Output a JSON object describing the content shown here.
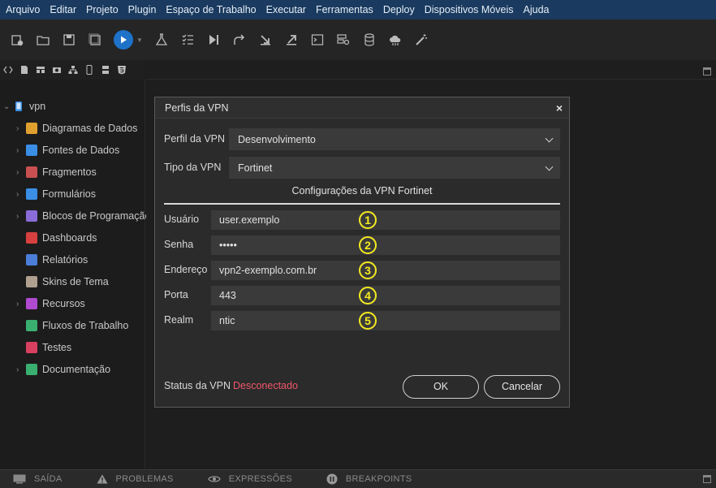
{
  "menu": [
    "Arquivo",
    "Editar",
    "Projeto",
    "Plugin",
    "Espaço de Trabalho",
    "Executar",
    "Ferramentas",
    "Deploy",
    "Dispositivos Móveis",
    "Ajuda"
  ],
  "project": {
    "name": "vpn"
  },
  "tree": [
    {
      "label": "Diagramas de Dados",
      "icon": "diagram-icon",
      "color": "#e0a030",
      "expand": true
    },
    {
      "label": "Fontes de Dados",
      "icon": "datasource-icon",
      "color": "#3a8ee6",
      "expand": true
    },
    {
      "label": "Fragmentos",
      "icon": "fragment-icon",
      "color": "#c85050",
      "expand": true
    },
    {
      "label": "Formulários",
      "icon": "form-icon",
      "color": "#3a8ee6",
      "expand": true
    },
    {
      "label": "Blocos de Programação",
      "icon": "blocks-icon",
      "color": "#8a6cd8",
      "expand": true
    },
    {
      "label": "Dashboards",
      "icon": "dashboard-icon",
      "color": "#d84040",
      "expand": false
    },
    {
      "label": "Relatórios",
      "icon": "report-icon",
      "color": "#4a7ed8",
      "expand": false
    },
    {
      "label": "Skins de Tema",
      "icon": "palette-icon",
      "color": "#b0a090",
      "expand": false
    },
    {
      "label": "Recursos",
      "icon": "resources-icon",
      "color": "#b04ad0",
      "expand": true
    },
    {
      "label": "Fluxos de Trabalho",
      "icon": "workflow-icon",
      "color": "#3ab070",
      "expand": false
    },
    {
      "label": "Testes",
      "icon": "test-icon",
      "color": "#d84060",
      "expand": false
    },
    {
      "label": "Documentação",
      "icon": "doc-icon",
      "color": "#3ab070",
      "expand": true
    }
  ],
  "bottom_tabs": [
    "SAÍDA",
    "PROBLEMAS",
    "EXPRESSÕES",
    "BREAKPOINTS"
  ],
  "dialog": {
    "title": "Perfis da VPN",
    "profile_label": "Perfil da VPN",
    "profile_value": "Desenvolvimento",
    "type_label": "Tipo da VPN",
    "type_value": "Fortinet",
    "section_title": "Configurações da VPN Fortinet",
    "fields": [
      {
        "label": "Usuário",
        "value": "user.exemplo",
        "badge": "1"
      },
      {
        "label": "Senha",
        "value": "•••••",
        "badge": "2"
      },
      {
        "label": "Endereço",
        "value": "vpn2-exemplo.com.br",
        "badge": "3"
      },
      {
        "label": "Porta",
        "value": "443",
        "badge": "4"
      },
      {
        "label": "Realm",
        "value": "ntic",
        "badge": "5"
      }
    ],
    "status_label": "Status da VPN",
    "status_value": "Desconectado",
    "ok_label": "OK",
    "cancel_label": "Cancelar"
  }
}
